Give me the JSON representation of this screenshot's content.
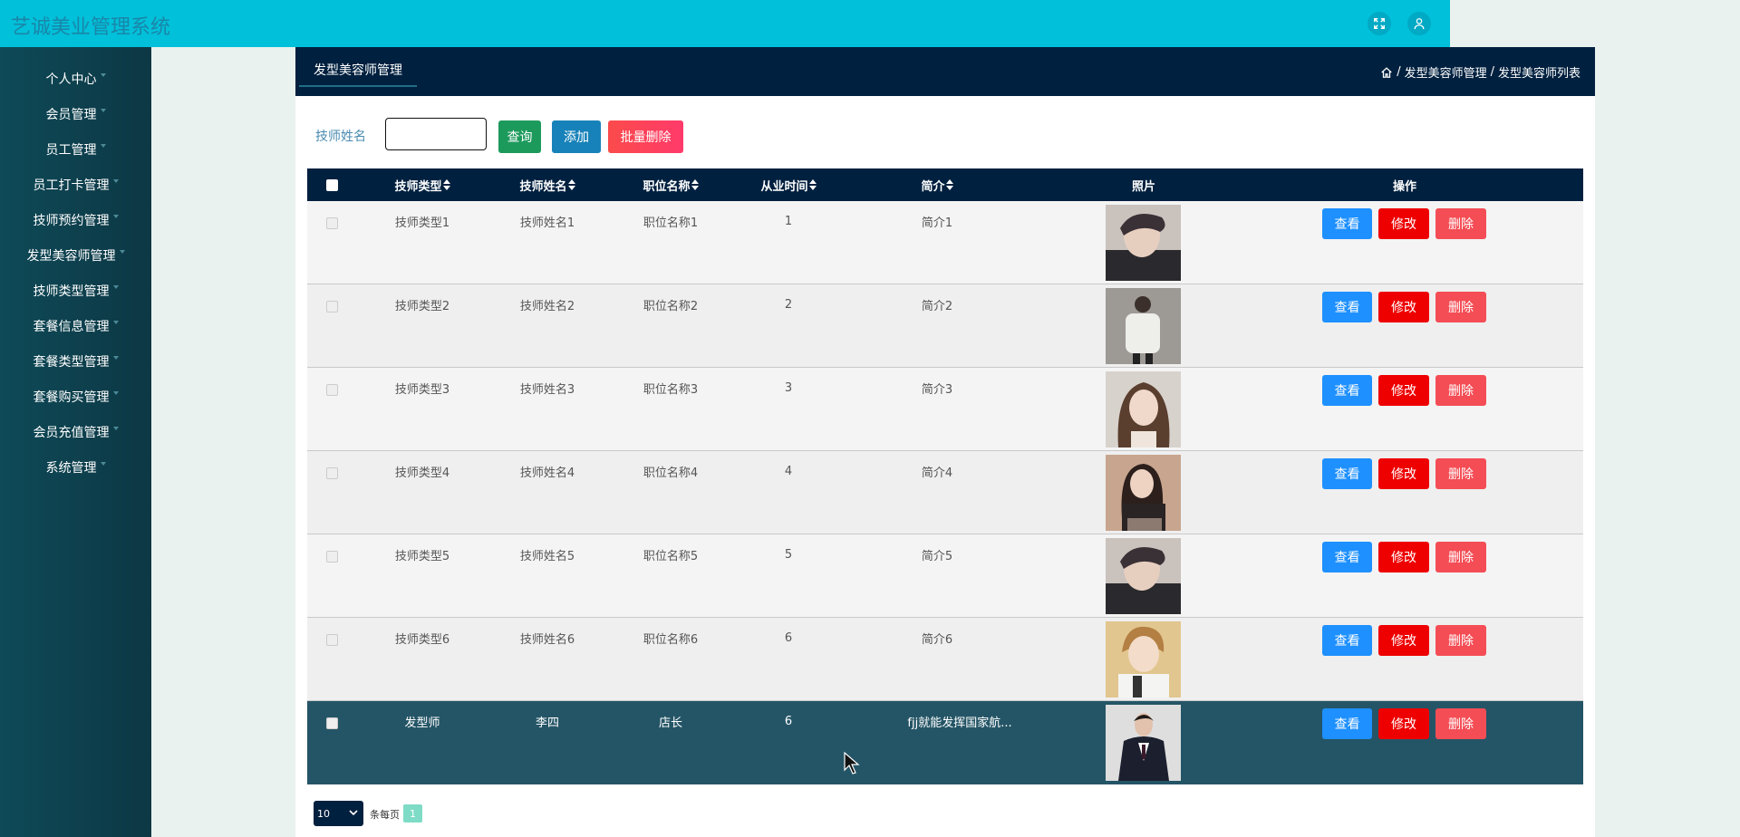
{
  "app": {
    "title": "艺诚美业管理系统"
  },
  "header": {
    "fullscreen_icon": "fullscreen-icon",
    "user_icon": "user-icon"
  },
  "sidebar": {
    "items": [
      {
        "label": "个人中心"
      },
      {
        "label": "会员管理"
      },
      {
        "label": "员工管理"
      },
      {
        "label": "员工打卡管理"
      },
      {
        "label": "技师预约管理"
      },
      {
        "label": "发型美容师管理"
      },
      {
        "label": "技师类型管理"
      },
      {
        "label": "套餐信息管理"
      },
      {
        "label": "套餐类型管理"
      },
      {
        "label": "套餐购买管理"
      },
      {
        "label": "会员充值管理"
      },
      {
        "label": "系统管理"
      }
    ]
  },
  "panel": {
    "tab_label": "发型美容师管理",
    "breadcrumb": {
      "sep1": "/",
      "level1": "发型美容师管理",
      "sep2": "/",
      "level2": "发型美容师列表"
    }
  },
  "search": {
    "label": "技师姓名",
    "value": "",
    "placeholder": "",
    "query_label": "查询",
    "add_label": "添加",
    "bulk_delete_label": "批量删除"
  },
  "table": {
    "columns": [
      "技师类型",
      "技师姓名",
      "职位名称",
      "从业时间",
      "简介",
      "照片",
      "操作"
    ],
    "actions": {
      "view": "查看",
      "edit": "修改",
      "delete": "删除"
    },
    "rows": [
      {
        "type": "技师类型1",
        "name": "技师姓名1",
        "position": "职位名称1",
        "years": "1",
        "intro": "简介1"
      },
      {
        "type": "技师类型2",
        "name": "技师姓名2",
        "position": "职位名称2",
        "years": "2",
        "intro": "简介2"
      },
      {
        "type": "技师类型3",
        "name": "技师姓名3",
        "position": "职位名称3",
        "years": "3",
        "intro": "简介3"
      },
      {
        "type": "技师类型4",
        "name": "技师姓名4",
        "position": "职位名称4",
        "years": "4",
        "intro": "简介4"
      },
      {
        "type": "技师类型5",
        "name": "技师姓名5",
        "position": "职位名称5",
        "years": "5",
        "intro": "简介5"
      },
      {
        "type": "技师类型6",
        "name": "技师姓名6",
        "position": "职位名称6",
        "years": "6",
        "intro": "简介6"
      },
      {
        "type": "发型师",
        "name": "李四",
        "position": "店长",
        "years": "6",
        "intro": "fjj就能发挥国家航..."
      }
    ]
  },
  "pagination": {
    "page_size": "10",
    "per_page_label": "条每页",
    "current_page": "1"
  },
  "colors": {
    "header": "#00c0da",
    "sidebar": "#0e4a58",
    "panel_head": "#00203f",
    "active_row": "#245566"
  }
}
